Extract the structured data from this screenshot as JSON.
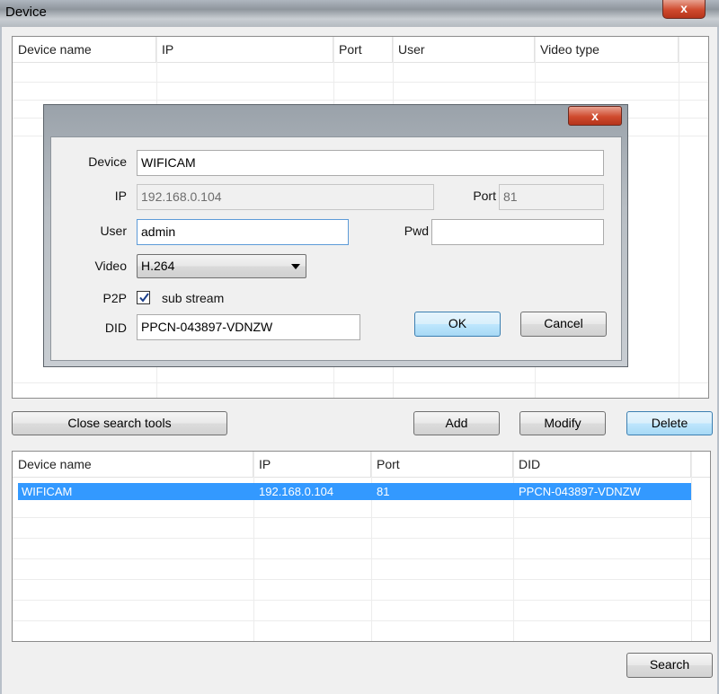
{
  "window": {
    "title": "Device",
    "close_glyph": "x"
  },
  "top_table": {
    "columns": [
      "Device name",
      "IP",
      "Port",
      "User",
      "Video type"
    ],
    "rows": []
  },
  "dialog": {
    "close_glyph": "x",
    "labels": {
      "device": "Device",
      "ip": "IP",
      "port": "Port",
      "user": "User",
      "pwd": "Pwd",
      "video": "Video",
      "p2p": "P2P",
      "did": "DID",
      "sub_stream": "sub stream"
    },
    "values": {
      "device": "WIFICAM",
      "ip": "192.168.0.104",
      "port": "81",
      "user": "admin",
      "pwd": "",
      "video": "H.264",
      "p2p_checked": true,
      "did": "PPCN-043897-VDNZW"
    },
    "buttons": {
      "ok": "OK",
      "cancel": "Cancel"
    }
  },
  "toolbar": {
    "close_search_tools": "Close search tools",
    "add": "Add",
    "modify": "Modify",
    "delete": "Delete"
  },
  "bottom_table": {
    "columns": [
      "Device name",
      "IP",
      "Port",
      "DID"
    ],
    "rows": [
      {
        "device_name": "WIFICAM",
        "ip": "192.168.0.104",
        "port": "81",
        "did": "PPCN-043897-VDNZW",
        "selected": true
      }
    ]
  },
  "footer": {
    "search": "Search"
  },
  "colors": {
    "selection": "#3399ff",
    "close_red": "#cf4a2e",
    "focus_button": "#bee6fd"
  },
  "icons": {
    "window_close": "close-icon",
    "dialog_close": "close-icon",
    "combo": "chevron-down-icon",
    "checkbox": "checkmark-icon"
  }
}
